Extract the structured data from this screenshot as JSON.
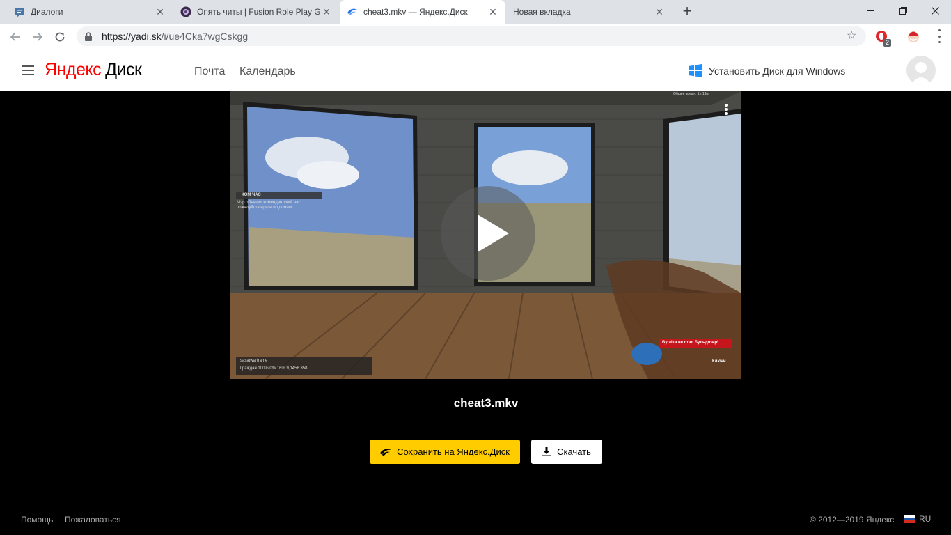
{
  "browser": {
    "tabs": [
      {
        "title": "Диалоги",
        "favicon": "vk-dialogs-icon",
        "active": false
      },
      {
        "title": "Опять читы | Fusion Role Play Gr",
        "favicon": "fusion-rp-icon",
        "active": false
      },
      {
        "title": "cheat3.mkv — Яндекс.Диск",
        "favicon": "yandex-disk-icon",
        "active": true
      },
      {
        "title": "Новая вкладка",
        "favicon": "",
        "active": false
      }
    ],
    "url_host": "https://yadi.sk",
    "url_path": "/i/ue4Cka7wgCskgg",
    "extension_badge": "2"
  },
  "header": {
    "logo_yandex": "Яндекс",
    "logo_disk": "Диск",
    "nav": [
      "Почта",
      "Календарь"
    ],
    "install_label": "Установить Диск для Windows"
  },
  "player": {
    "filename": "cheat3.mkv",
    "hud": {
      "chat_title": "КОМ ЧАС",
      "chat_line1": "Мэр объявил комендантский час.",
      "chat_line2": "пожалуйста идите по домам!",
      "player_name": "sasatwarframe",
      "stats": "Граждан    100%    0%    16%    9,1458    358",
      "warning": "Bytaika не стал Бульдозер!",
      "keys": "Ключи",
      "top_right": "Общее время: 1h 13m"
    }
  },
  "actions": {
    "save_label": "Сохранить на Яндекс.Диск",
    "download_label": "Скачать"
  },
  "footer": {
    "help": "Помощь",
    "report": "Пожаловаться",
    "copyright": "© 2012—2019 Яндекс",
    "lang": "RU"
  },
  "colors": {
    "yandex_red": "#ff0000",
    "save_button": "#ffcc00",
    "page_bg": "#000000"
  }
}
